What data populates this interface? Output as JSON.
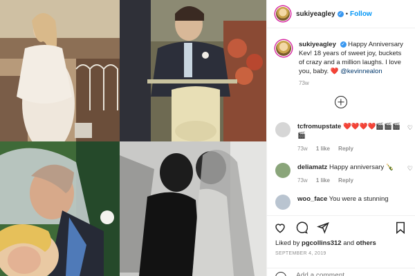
{
  "post": {
    "username": "sukiyeagley",
    "separator": "•",
    "follow_label": "Follow",
    "verified_glyph": "✓"
  },
  "caption": {
    "username": "sukiyeagley",
    "text": "Happy Anniversary Kev! 18 years of sweet joy, buckets of crazy and a million laughs. I love you, baby.",
    "emoji": "❤️",
    "mention": "@kevinnealon",
    "time": "73w"
  },
  "comments": [
    {
      "username": "tcfromupstate",
      "text": "❤️❤️❤️❤️🎬🎬🎬🎬",
      "time": "73w",
      "likes": "1 like",
      "reply": "Reply",
      "avatar_color": "#cfcfcf"
    },
    {
      "username": "deliamatz",
      "text": "Happy anniversary 🍾",
      "time": "73w",
      "likes": "1 like",
      "reply": "Reply",
      "avatar_color": "#8aa57a"
    },
    {
      "username": "woo_face",
      "text": "You were a stunning",
      "avatar_color": "#b9c4d0"
    }
  ],
  "actions": {
    "liked_by_prefix": "Liked by",
    "liked_by_user": "pgcollins312",
    "liked_by_and": "and",
    "liked_by_others": "others",
    "date": "SEPTEMBER 4, 2019"
  },
  "add_comment": {
    "placeholder": "Add a comment..."
  },
  "icons": {
    "like": "heart-outline-icon",
    "comment": "comment-bubble-icon",
    "share": "paper-plane-icon",
    "save": "bookmark-icon",
    "emoji": "smiley-icon",
    "load_more": "plus-circle-icon"
  },
  "colors": {
    "accent": "#0095f6",
    "verified": "#3897f0",
    "heart": "#e0245e"
  }
}
